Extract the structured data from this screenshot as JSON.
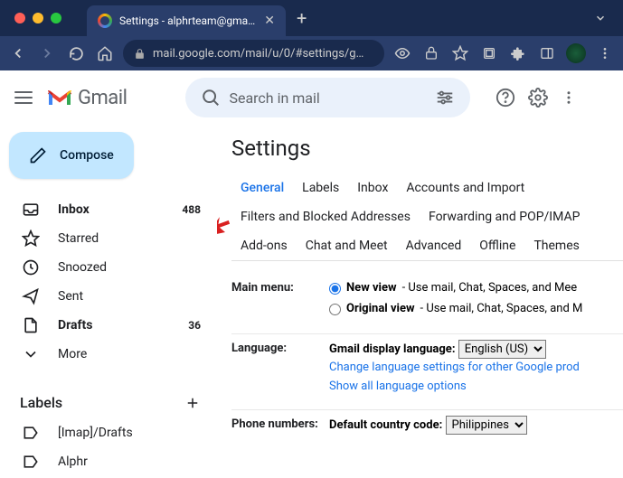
{
  "browser": {
    "tab_title": "Settings - alphrteam@gmail.c…",
    "url": "mail.google.com/mail/u/0/#settings/g…"
  },
  "header": {
    "app_name": "Gmail",
    "search_placeholder": "Search in mail"
  },
  "sidebar": {
    "compose": "Compose",
    "items": [
      {
        "label": "Inbox",
        "count": "488",
        "bold": true
      },
      {
        "label": "Starred"
      },
      {
        "label": "Snoozed"
      },
      {
        "label": "Sent"
      },
      {
        "label": "Drafts",
        "count": "36",
        "bold": true
      },
      {
        "label": "More"
      }
    ],
    "labels_header": "Labels",
    "labels": [
      {
        "label": "[Imap]/Drafts"
      },
      {
        "label": "Alphr"
      }
    ]
  },
  "settings": {
    "title": "Settings",
    "tabs": [
      "General",
      "Labels",
      "Inbox",
      "Accounts and Import",
      "Filters and Blocked Addresses",
      "Forwarding and POP/IMAP",
      "Add-ons",
      "Chat and Meet",
      "Advanced",
      "Offline",
      "Themes"
    ],
    "main_menu": {
      "label": "Main menu:",
      "new_view": "New view",
      "new_view_desc": " - Use mail, Chat, Spaces, and Mee",
      "original_view": "Original view",
      "original_view_desc": " - Use mail, Chat, Spaces, and M"
    },
    "language": {
      "label": "Language:",
      "display_label": "Gmail display language:",
      "selected": "English (US)",
      "change_link": "Change language settings for other Google prod",
      "show_all_link": "Show all language options"
    },
    "phone": {
      "label": "Phone numbers:",
      "default_label": "Default country code:",
      "selected": "Philippines"
    }
  }
}
